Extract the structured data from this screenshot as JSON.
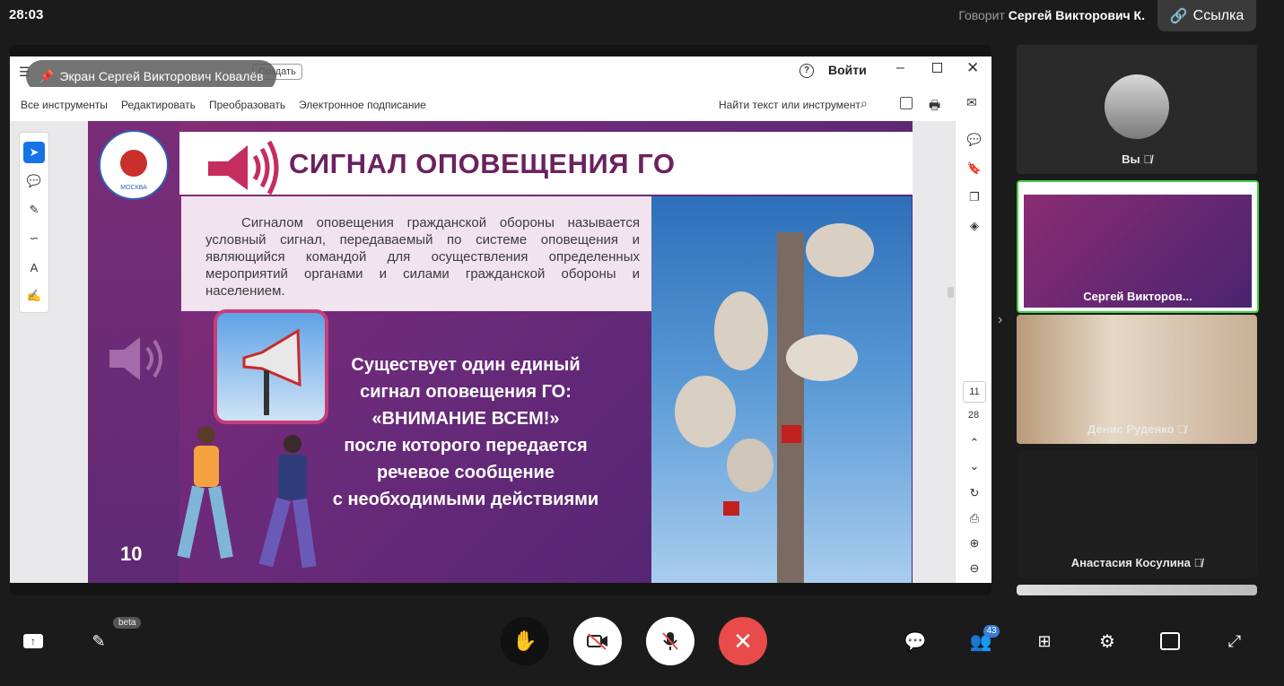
{
  "top_bar": {
    "timer": "28:03",
    "speaker_prefix": "Говорит",
    "speaker_name": "Сергей Викторович К.",
    "link_label": "Ссылка"
  },
  "share": {
    "screen_label": "Экран Сергей Викторович Ковалёв",
    "create_label": "Создать",
    "help_icon": "help-icon",
    "signin_label": "Войти",
    "toolbar": {
      "all_tools": "Все инструменты",
      "edit": "Редактировать",
      "convert": "Преобразовать",
      "esign": "Электронное подписание",
      "search": "Найти текст или инструмент"
    },
    "page_current": "11",
    "page_total": "28"
  },
  "slide": {
    "title": "СИГНАЛ ОПОВЕЩЕНИЯ ГО",
    "logo_text": "УЧЕБНО-МЕТОДИЧЕСКИЙ ЦЕНТР ГОиЧС",
    "logo_city": "МОСКВА",
    "body": "Сигналом оповещения гражданской обороны называется условный сигнал, передаваемый по системе оповещения и являющийся командой для осуществления определенных мероприятий органами и силами гражданской обороны и населением.",
    "main_lines": [
      "Существует один единый",
      "сигнал оповещения ГО:",
      "«ВНИМАНИЕ ВСЕМ!»",
      "после которого передается",
      "речевое сообщение",
      "с необходимыми действиями"
    ],
    "page_number": "10"
  },
  "participants": [
    {
      "name": "Вы"
    },
    {
      "name": "Сергей Викторов..."
    },
    {
      "name": "Денис Руденко"
    },
    {
      "name": "Анастасия Косулина"
    }
  ],
  "bottom": {
    "beta_label": "beta",
    "participants_count": "43"
  },
  "colors": {
    "accent_red": "#e94b4b",
    "active_border": "#3fd13f",
    "slide_purple": "#6b2160"
  }
}
